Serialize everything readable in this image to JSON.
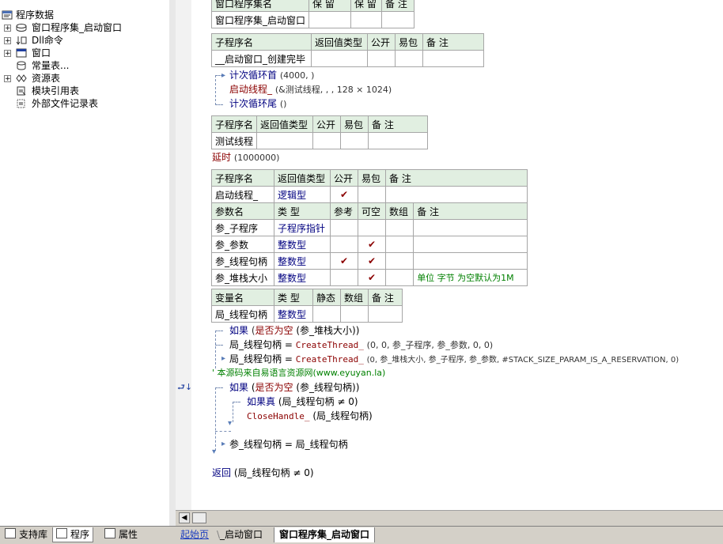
{
  "tree": {
    "root": "程序数据",
    "items": [
      {
        "label": "窗口程序集_启动窗口",
        "icon": "assembly-icon",
        "expander": "+"
      },
      {
        "label": "Dll命令",
        "icon": "dll-icon",
        "expander": "+"
      },
      {
        "label": "窗口",
        "icon": "window-icon",
        "expander": "+"
      },
      {
        "label": "常量表...",
        "icon": "constant-icon",
        "expander": ""
      },
      {
        "label": "资源表",
        "icon": "resource-icon",
        "expander": "+"
      },
      {
        "label": "模块引用表",
        "icon": "module-ref-icon",
        "expander": ""
      },
      {
        "label": "外部文件记录表",
        "icon": "external-file-icon",
        "expander": ""
      }
    ]
  },
  "left_tabs": [
    "支持库",
    "程序",
    "属性"
  ],
  "editor_tabs": [
    "起始页",
    "_启动窗口",
    "窗口程序集_启动窗口"
  ],
  "assembly_table": {
    "headers": [
      "窗口程序集名",
      "保 留",
      "保 留",
      "备 注"
    ],
    "row": [
      "窗口程序集_启动窗口",
      "",
      "",
      ""
    ]
  },
  "sub1": {
    "headers": [
      "子程序名",
      "返回值类型",
      "公开",
      "易包",
      "备 注"
    ],
    "row": [
      "__启动窗口_创建完毕",
      "",
      "",
      "",
      ""
    ]
  },
  "code1": {
    "loop_head": "计次循环首",
    "loop_args": "(4000, )",
    "call": "启动线程_",
    "call_args": "(&测试线程, , , 128 × 1024)",
    "loop_tail": "计次循环尾",
    "loop_tail_args": "()"
  },
  "sub2": {
    "headers": [
      "子程序名",
      "返回值类型",
      "公开",
      "易包",
      "备 注"
    ],
    "row": [
      "测试线程",
      "",
      "",
      "",
      ""
    ]
  },
  "code2": {
    "call": "延时",
    "args": "(1000000)"
  },
  "sub3": {
    "headers": [
      "子程序名",
      "返回值类型",
      "公开",
      "易包",
      "备 注"
    ],
    "row": [
      "启动线程_",
      "逻辑型",
      "✔",
      "",
      ""
    ],
    "param_headers": [
      "参数名",
      "类 型",
      "参考",
      "可空",
      "数组",
      "备 注"
    ],
    "params": [
      {
        "name": "参_子程序",
        "type": "子程序指针",
        "ref": "",
        "nullable": "",
        "array": "",
        "note": ""
      },
      {
        "name": "参_参数",
        "type": "整数型",
        "ref": "",
        "nullable": "✔",
        "array": "",
        "note": ""
      },
      {
        "name": "参_线程句柄",
        "type": "整数型",
        "ref": "✔",
        "nullable": "✔",
        "array": "",
        "note": ""
      },
      {
        "name": "参_堆栈大小",
        "type": "整数型",
        "ref": "",
        "nullable": "✔",
        "array": "",
        "note": "单位 字节 为空默认为1M"
      }
    ],
    "var_headers": [
      "变量名",
      "类 型",
      "静态",
      "数组",
      "备 注"
    ],
    "vars": [
      {
        "name": "局_线程句柄",
        "type": "整数型",
        "static": "",
        "array": "",
        "note": ""
      }
    ]
  },
  "code3": {
    "if1_kw": "如果",
    "if1_fn": "是否为空",
    "if1_args": "(参_堆栈大小))",
    "assign1_var": "局_线程句柄",
    "assign1_op": "=",
    "assign1_fn": "CreateThread_",
    "assign1_args": "(0, 0, 参_子程序, 参_参数, 0, 0)",
    "assign2_var": "局_线程句柄",
    "assign2_op": "=",
    "assign2_fn": "CreateThread_",
    "assign2_args": "(0, 参_堆栈大小, 参_子程序, 参_参数, #STACK_SIZE_PARAM_IS_A_RESERVATION, 0)",
    "comment": "' 本源码来自易语言资源网(www.eyuyan.la)",
    "gutter_mark": "⮐↓+",
    "if2_kw": "如果",
    "if2_fn": "是否为空",
    "if2_args": "(参_线程句柄))",
    "iftrue_kw": "如果真",
    "iftrue_args": "(局_线程句柄 ≠ 0)",
    "close_fn": "CloseHandle_",
    "close_args": "(局_线程句柄)",
    "assign3": "参_线程句柄 = 局_线程句柄",
    "return_kw": "返回",
    "return_args": "(局_线程句柄 ≠ 0)"
  }
}
